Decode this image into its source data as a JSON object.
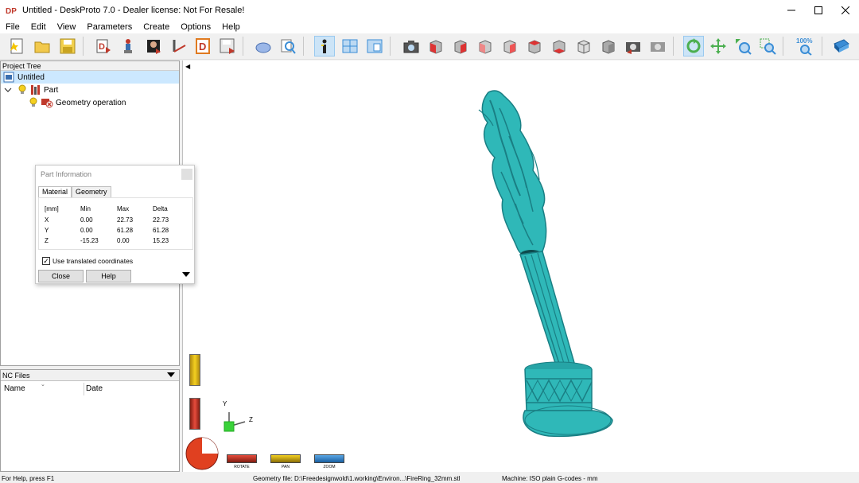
{
  "window": {
    "title": "Untitled - DeskProto 7.0 - Dealer license: Not For Resale!",
    "app_icon_text": "DP"
  },
  "menu": [
    "File",
    "Edit",
    "View",
    "Parameters",
    "Create",
    "Options",
    "Help"
  ],
  "toolbar": {
    "zoom_level": "100%"
  },
  "project_tree": {
    "caption": "Project Tree",
    "root": "Untitled",
    "part": "Part",
    "operation": "Geometry operation"
  },
  "nc_files": {
    "caption": "NC Files",
    "col_name": "Name",
    "col_date": "Date"
  },
  "part_info": {
    "title": "Part Information",
    "tabs": [
      "Material",
      "Geometry"
    ],
    "headers": [
      "[mm]",
      "Min",
      "Max",
      "Delta"
    ],
    "rows": [
      [
        "X",
        "0.00",
        "22.73",
        "22.73"
      ],
      [
        "Y",
        "0.00",
        "61.28",
        "61.28"
      ],
      [
        "Z",
        "-15.23",
        "0.00",
        "15.23"
      ]
    ],
    "use_translated": "Use translated coordinates",
    "close_label": "Close",
    "help_label": "Help"
  },
  "axes": {
    "y": "Y",
    "z": "Z"
  },
  "modes": {
    "rotate": "ROTATE",
    "pan": "PAN",
    "zoom": "ZOOM"
  },
  "status": {
    "help": "For Help, press F1",
    "geometry": "Geometry file: D:\\Freedesignwold\\1.working\\Environ...\\FireRing_32mm.stl",
    "machine": "Machine: ISO plain G-codes - mm"
  },
  "colors": {
    "model": "#2fb8b8",
    "model_dark": "#1a7f84",
    "selected": "#cce8ff",
    "accent_red": "#c0392b",
    "yellow": "#f4d020",
    "blue": "#3a8dd6"
  }
}
